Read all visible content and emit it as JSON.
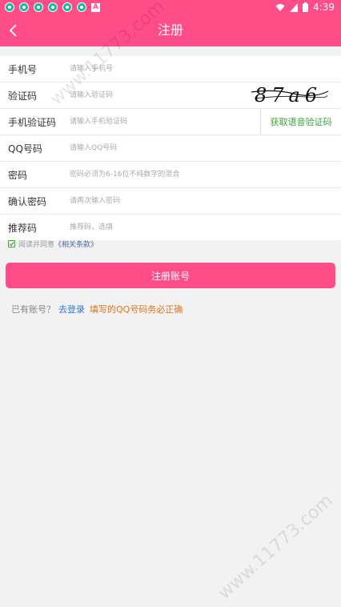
{
  "status_bar": {
    "time": "4:39",
    "app_icon_count": 6,
    "a_icon": "A"
  },
  "header": {
    "title": "注册",
    "back_icon": "chevron-left-icon",
    "color": "#ff4d88"
  },
  "form": {
    "phone": {
      "label": "手机号",
      "placeholder": "请输入手机号"
    },
    "captcha": {
      "label": "验证码",
      "placeholder": "请输入验证码",
      "image_text": "87a6"
    },
    "sms_code": {
      "label": "手机验证码",
      "placeholder": "请输入手机验证码",
      "voice_button": "获取语音验证码"
    },
    "qq": {
      "label": "QQ号码",
      "placeholder": "请输入QQ号码"
    },
    "password": {
      "label": "密码",
      "placeholder": "密码必须为6-16位不纯数字的混合"
    },
    "confirm": {
      "label": "确认密码",
      "placeholder": "请再次输入密码"
    },
    "referrer": {
      "label": "推荐码",
      "placeholder": "推荐码，选填"
    }
  },
  "agreement": {
    "text": "阅读并同意",
    "link": "《相关条款》",
    "checked": true
  },
  "register_button": "注册账号",
  "login_prompt": {
    "text": "已有账号？",
    "link": "去登录",
    "warning": "填写的QQ号码务必正确"
  },
  "watermark": "www.11773.com"
}
